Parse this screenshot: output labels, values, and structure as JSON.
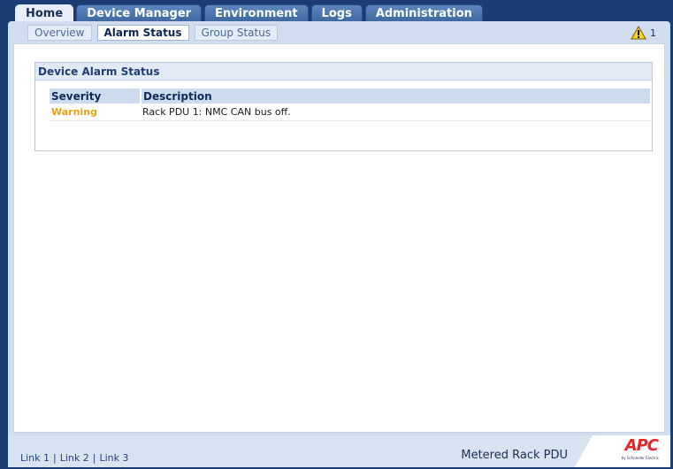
{
  "top_tabs": [
    {
      "label": "Home",
      "active": true
    },
    {
      "label": "Device Manager",
      "active": false
    },
    {
      "label": "Environment",
      "active": false
    },
    {
      "label": "Logs",
      "active": false
    },
    {
      "label": "Administration",
      "active": false
    }
  ],
  "sub_tabs": [
    {
      "label": "Overview",
      "active": false
    },
    {
      "label": "Alarm Status",
      "active": true
    },
    {
      "label": "Group Status",
      "active": false
    }
  ],
  "alert": {
    "count": "1",
    "icon": "warning-icon"
  },
  "alarm_box": {
    "title": "Device Alarm Status",
    "columns": [
      "Severity",
      "Description"
    ],
    "rows": [
      {
        "severity": "Warning",
        "description": "Rack PDU 1: NMC CAN bus off."
      }
    ]
  },
  "footer": {
    "links": [
      "Link 1",
      "Link 2",
      "Link 3"
    ],
    "separator": "|",
    "product_name": "Metered Rack PDU",
    "logo_text": "APC",
    "logo_sub": "by Schneider Electric"
  },
  "colors": {
    "background": "#1c3c74",
    "warning": "#e8a317",
    "logo_red": "#e3262a"
  }
}
